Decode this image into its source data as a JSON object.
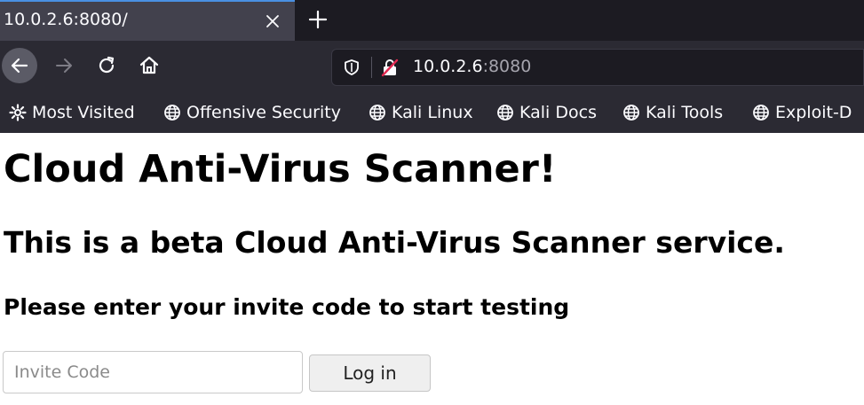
{
  "browser": {
    "tab": {
      "title": "10.0.2.6:8080/",
      "close_icon": "close-icon"
    },
    "new_tab_icon": "plus-icon",
    "nav": {
      "back_icon": "arrow-left-icon",
      "forward_icon": "arrow-right-icon",
      "reload_icon": "reload-icon",
      "home_icon": "home-icon"
    },
    "urlbar": {
      "host": "10.0.2.6",
      "port": ":8080",
      "shield_icon": "shield-icon",
      "insecure_icon": "insecure-lock-icon"
    },
    "bookmarks": [
      {
        "label": "Most Visited",
        "icon": "gear-icon"
      },
      {
        "label": "Offensive Security",
        "icon": "globe-icon"
      },
      {
        "label": "Kali Linux",
        "icon": "globe-icon"
      },
      {
        "label": "Kali Docs",
        "icon": "globe-icon"
      },
      {
        "label": "Kali Tools",
        "icon": "globe-icon"
      },
      {
        "label": "Exploit-D",
        "icon": "globe-icon"
      }
    ]
  },
  "page": {
    "heading": "Cloud Anti-Virus Scanner!",
    "subheading": "This is a beta Cloud Anti-Virus Scanner service.",
    "prompt": "Please enter your invite code to start testing",
    "invite_placeholder": "Invite Code",
    "login_label": "Log in"
  },
  "colors": {
    "chrome_bg": "#2b2a33",
    "tabstrip_bg": "#1c1b22",
    "active_tab_bg": "#42414d",
    "tab_accent": "#4a90e2",
    "insecure_red": "#e22850"
  }
}
